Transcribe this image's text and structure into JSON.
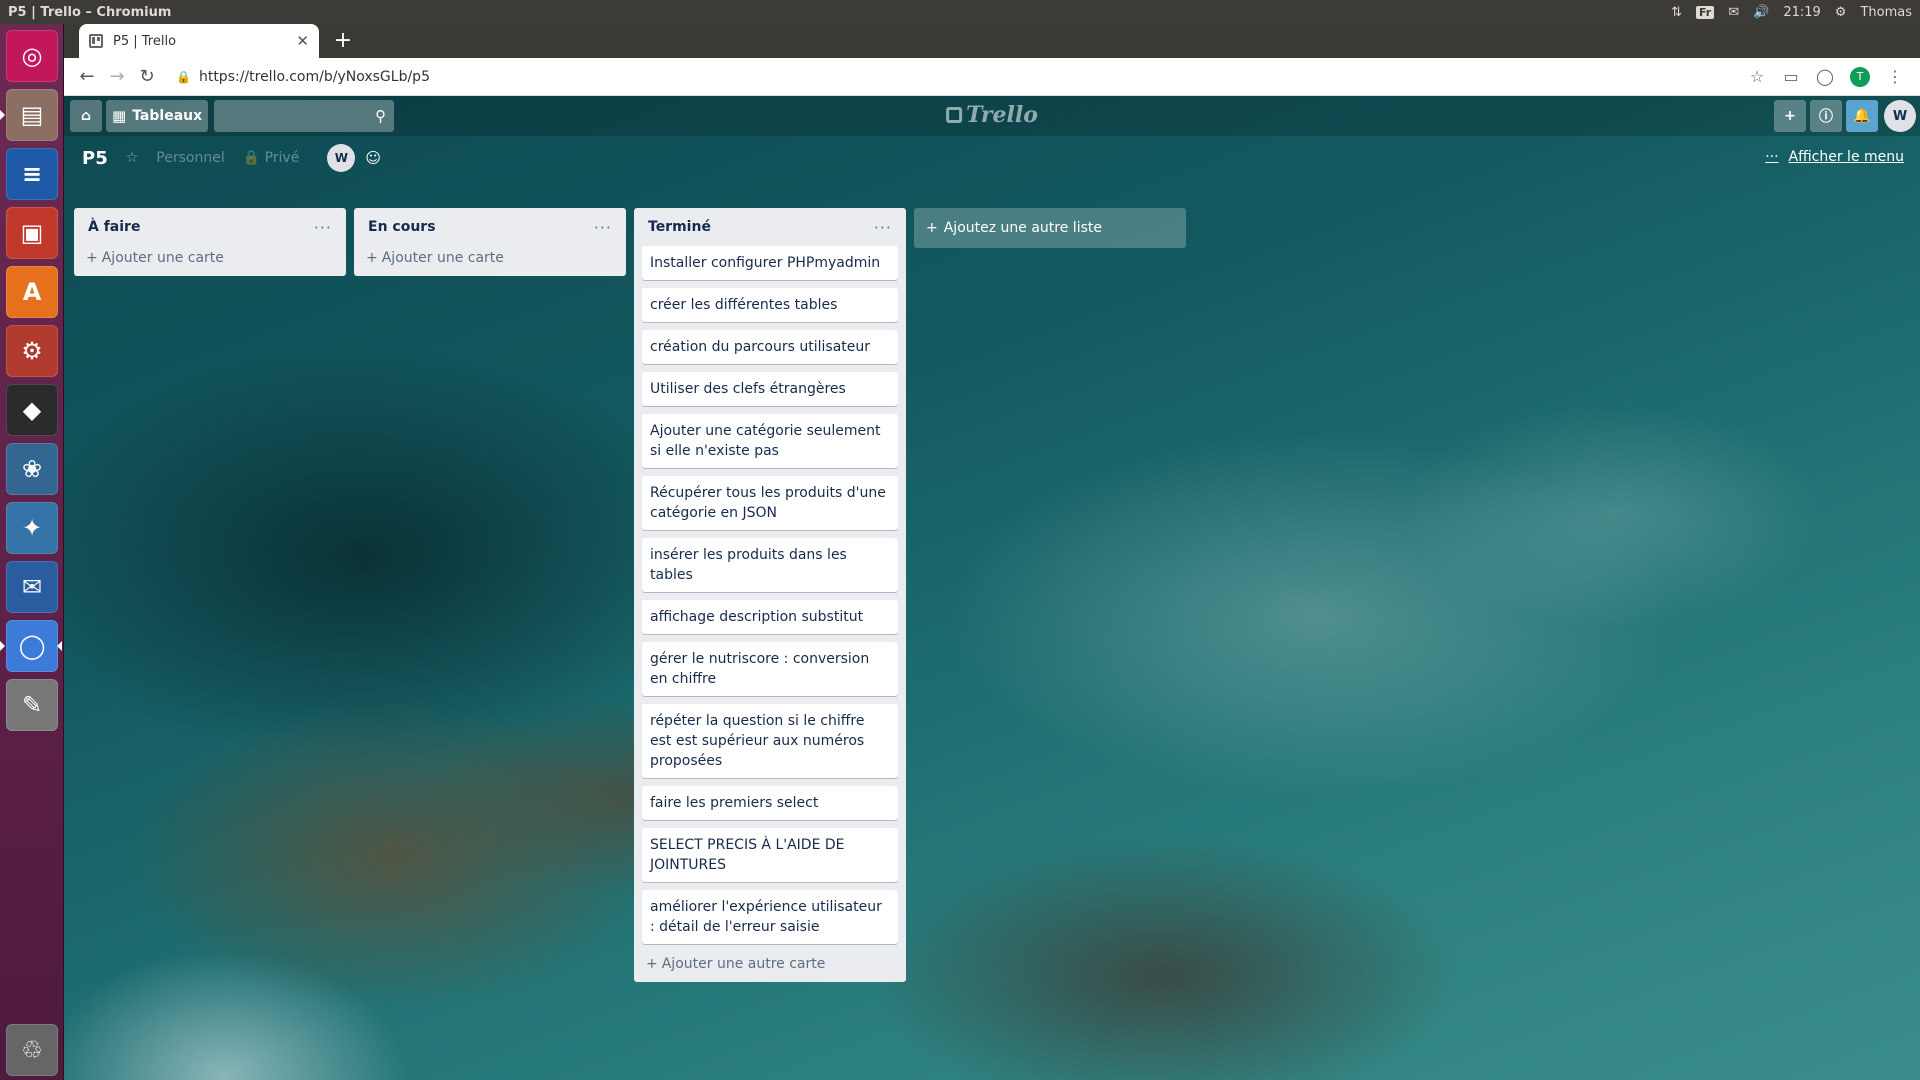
{
  "os": {
    "window_title": "P5 | Trello – Chromium",
    "keyboard_layout": "Fr",
    "clock": "21:19",
    "user": "Thomas"
  },
  "launcher": {
    "apps": [
      {
        "name": "ubuntu-dash",
        "glyph": "◎",
        "color": "#c2185b"
      },
      {
        "name": "files",
        "glyph": "▤",
        "color": "#8d6e63"
      },
      {
        "name": "libreoffice-writer",
        "glyph": "≡",
        "color": "#1e5aa8"
      },
      {
        "name": "libreoffice-impress",
        "glyph": "▣",
        "color": "#c0392b"
      },
      {
        "name": "software-center",
        "glyph": "A",
        "color": "#e6711c"
      },
      {
        "name": "system-settings",
        "glyph": "⚙",
        "color": "#b03a2e"
      },
      {
        "name": "inkscape",
        "glyph": "◆",
        "color": "#2b2b2b"
      },
      {
        "name": "pgadmin",
        "glyph": "❀",
        "color": "#336791"
      },
      {
        "name": "python",
        "glyph": "✦",
        "color": "#3572a5"
      },
      {
        "name": "thunderbird",
        "glyph": "✉",
        "color": "#2a5d9f"
      },
      {
        "name": "chromium",
        "glyph": "◯",
        "color": "#3d7bd9"
      },
      {
        "name": "text-editor",
        "glyph": "✎",
        "color": "#777777"
      },
      {
        "name": "trash",
        "glyph": "♲",
        "color": "#666666"
      }
    ]
  },
  "browser": {
    "tab_title": "P5 | Trello",
    "url": "https://trello.com/b/yNoxsGLb/p5",
    "profile_initial": "T"
  },
  "trello": {
    "boards_label": "Tableaux",
    "search_value": "",
    "logo_text": "Trello",
    "account_initial": "W",
    "board": {
      "title": "P5",
      "team": "Personnel",
      "visibility": "Privé",
      "member_initial": "W",
      "show_menu": "Afficher le menu"
    },
    "lists": [
      {
        "title": "À faire",
        "cards": [],
        "add_label": "Ajouter une carte"
      },
      {
        "title": "En cours",
        "cards": [],
        "add_label": "Ajouter une carte"
      },
      {
        "title": "Terminé",
        "cards": [
          "Installer configurer PHPmyadmin",
          "créer les différentes tables",
          "création du parcours utilisateur",
          "Utiliser des clefs étrangères",
          "Ajouter une catégorie seulement si elle n'existe pas",
          "Récupérer tous les produits d'une catégorie en JSON",
          "insérer les produits dans les tables",
          "affichage description substitut",
          "gérer le nutriscore : conversion en chiffre",
          "répéter la question si le chiffre est est supérieur aux numéros proposées",
          "faire les premiers select",
          "SELECT PRECIS À L'AIDE DE JOINTURES",
          "améliorer l'expérience utilisateur : détail de l'erreur saisie"
        ],
        "add_label": "Ajouter une autre carte"
      }
    ],
    "add_list_label": "Ajoutez une autre liste"
  }
}
